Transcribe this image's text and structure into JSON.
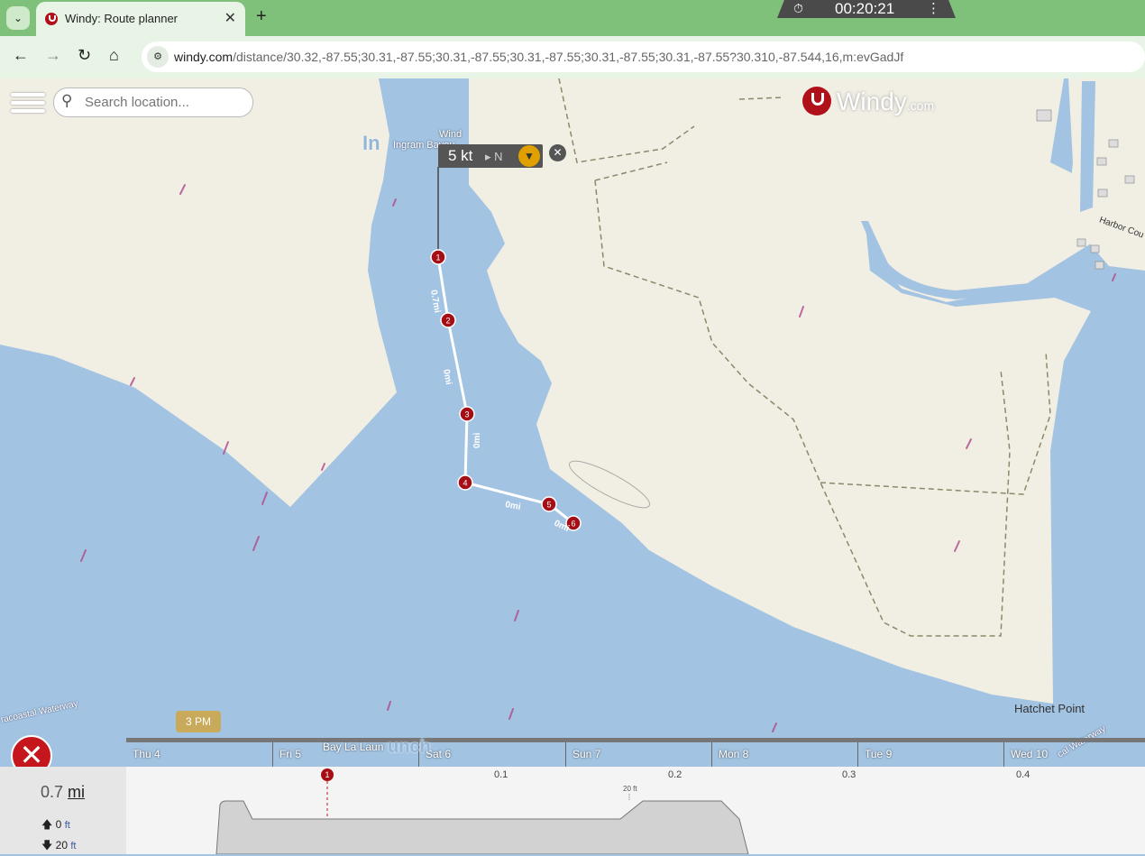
{
  "browser": {
    "tab_title": "Windy: Route planner",
    "tab_close": "✕",
    "new_tab": "+",
    "timer": "00:20:21",
    "url_host": "windy.com",
    "url_rest": "/distance/30.32,-87.55;30.31,-87.55;30.31,-87.55;30.31,-87.55;30.31,-87.55;30.31,-87.55?30.310,-87.544,16,m:evGadJf"
  },
  "map": {
    "search_placeholder": "Search location...",
    "logo": "Windy",
    "logo_suffix": ".com",
    "wind_label": "Wind",
    "wind_value": "5 kt",
    "wind_dir": "N",
    "wind_close": "✕",
    "place_ingram": "Ingram Bayou",
    "place_ing": "In",
    "place_hatchet": "Hatchet Point",
    "place_harbor": "Harbor Cou",
    "place_intracoastal": "racoastal Waterway",
    "place_intracoastal2": "cal Waterway",
    "place_bay": "Bay La Laun",
    "place_launch": "unch",
    "segments": [
      "0.7mi",
      "0mi",
      "0mi",
      "0mi",
      "0mi"
    ],
    "waypoints": [
      "1",
      "2",
      "3",
      "4",
      "5",
      "6"
    ]
  },
  "timeline": {
    "hour_tag": "3 PM",
    "days": [
      "Thu 4",
      "Fri 5",
      "Sat 6",
      "Sun 7",
      "Mon 8",
      "Tue 9",
      "Wed 10"
    ]
  },
  "panel": {
    "distance_value": "0.7",
    "distance_unit": "mi",
    "ascent_value": "0",
    "ascent_unit": "ft",
    "descent_value": "20",
    "descent_unit": "ft",
    "scale": [
      "0.1",
      "0.2",
      "0.3",
      "0.4"
    ],
    "profile_label": "20 ft",
    "waypoint": "1"
  },
  "colors": {
    "water": "#a2c3e2",
    "land": "#f1eee4",
    "route": "#ffffff",
    "waypoint": "#a50e14",
    "tabbar": "#7fc07a"
  }
}
